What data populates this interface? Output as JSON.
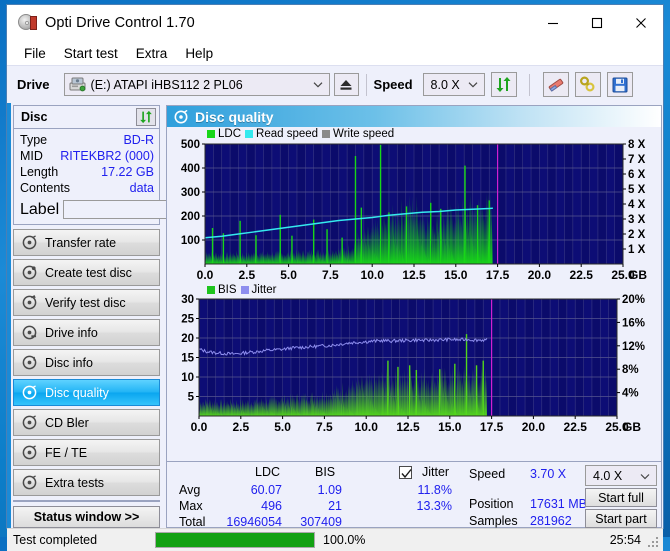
{
  "window": {
    "title": "Opti Drive Control 1.70",
    "icon": "disc-icon",
    "minimize": "–",
    "maximize": "□",
    "close": "✕"
  },
  "menu": {
    "items": [
      "File",
      "Start test",
      "Extra",
      "Help"
    ]
  },
  "toolbar": {
    "drive_label": "Drive",
    "drive_value": "(E:)  ATAPI iHBS112  2 PL06",
    "eject_icon": "eject-icon",
    "speed_label": "Speed",
    "speed_value": "8.0 X",
    "refresh_icon": "refresh-icon",
    "erase_icon": "eraser-icon",
    "tools_icon": "wrench-icon",
    "save_icon": "floppy-save-icon"
  },
  "disc_panel": {
    "title": "Disc",
    "refresh_icon": "refresh-icon",
    "rows": [
      {
        "key": "Type",
        "value": "BD-R"
      },
      {
        "key": "MID",
        "value": "RITEKBR2 (000)"
      },
      {
        "key": "Length",
        "value": "17.22 GB"
      },
      {
        "key": "Contents",
        "value": "data"
      }
    ],
    "label_key": "Label",
    "label_value": "",
    "label_placeholder": "",
    "cd_icon": "cd-disc-icon"
  },
  "nav": {
    "items": [
      {
        "label": "Transfer rate",
        "icon": "disc-icon",
        "selected": false
      },
      {
        "label": "Create test disc",
        "icon": "disc-icon",
        "selected": false
      },
      {
        "label": "Verify test disc",
        "icon": "disc-icon",
        "selected": false
      },
      {
        "label": "Drive info",
        "icon": "disc-icon",
        "selected": false
      },
      {
        "label": "Disc info",
        "icon": "disc-icon",
        "selected": false
      },
      {
        "label": "Disc quality",
        "icon": "disc-icon",
        "selected": true
      },
      {
        "label": "CD Bler",
        "icon": "disc-icon",
        "selected": false
      },
      {
        "label": "FE / TE",
        "icon": "disc-icon",
        "selected": false
      },
      {
        "label": "Extra tests",
        "icon": "disc-icon",
        "selected": false
      }
    ],
    "status_window": "Status window >>"
  },
  "panel": {
    "title": "Disc quality",
    "icon": "disc-icon"
  },
  "stats": {
    "col_ldc": "LDC",
    "col_bis": "BIS",
    "jitter_label": "Jitter",
    "jitter_checked": true,
    "rows": [
      {
        "name": "Avg",
        "ldc": "60.07",
        "bis": "1.09",
        "jitter": "11.8%"
      },
      {
        "name": "Max",
        "ldc": "496",
        "bis": "21",
        "jitter": "13.3%"
      },
      {
        "name": "Total",
        "ldc": "16946054",
        "bis": "307409",
        "jitter": ""
      }
    ],
    "speed_label": "Speed",
    "speed_value": "3.70 X",
    "position_label": "Position",
    "position_value": "17631 MB",
    "samples_label": "Samples",
    "samples_value": "281962",
    "speed_select": "4.0 X",
    "start_full": "Start full",
    "start_part": "Start part"
  },
  "statusbar": {
    "message": "Test completed",
    "percent": "100.0%",
    "percent_value": 100,
    "elapsed": "25:54"
  },
  "colors": {
    "ldc_green": "#18d618",
    "read_speed_cyan": "#34e9ee",
    "write_speed_gray": "#8a8a8a",
    "bis_green": "#53d61c",
    "jitter_violet": "#8e8eee",
    "plot_bg": "#0b0b6b",
    "accent_blue": "#1b8ad6",
    "value_blue": "#2020ee",
    "progress_green": "#12a112"
  },
  "chart_data": [
    {
      "type": "area",
      "name": "disc-quality-ldc",
      "title": "Disc quality",
      "legend": [
        {
          "label": "LDC",
          "color": "#18d618"
        },
        {
          "label": "Read speed",
          "color": "#34e9ee"
        },
        {
          "label": "Write speed",
          "color": "#8a8a8a"
        }
      ],
      "legend_position": "top-left",
      "grid": true,
      "xlabel": "GB",
      "xticks": [
        "0.0",
        "2.5",
        "5.0",
        "7.5",
        "10.0",
        "12.5",
        "15.0",
        "17.5",
        "20.0",
        "22.5",
        "25.0"
      ],
      "xlim": [
        0,
        25
      ],
      "ylabel_left": "LDC",
      "yticks_left": [
        "100",
        "200",
        "300",
        "400",
        "500"
      ],
      "ylim_left": [
        0,
        500
      ],
      "ylabel_right": "X",
      "yticks_right": [
        "1 X",
        "2 X",
        "3 X",
        "4 X",
        "5 X",
        "6 X",
        "7 X",
        "8 X"
      ],
      "ylim_right": [
        0,
        8
      ],
      "data_end_gb": 17.22,
      "marker_line_gb": 17.5,
      "series": [
        {
          "name": "LDC",
          "color": "#18d618",
          "x": [
            0.0,
            0.4,
            0.8,
            1.2,
            1.6,
            2.0,
            2.4,
            2.8,
            3.2,
            3.6,
            4.0,
            4.4,
            4.8,
            5.2,
            5.6,
            6.0,
            6.4,
            6.8,
            7.2,
            7.6,
            8.0,
            8.4,
            8.8,
            9.0,
            9.2,
            9.6,
            10.0,
            10.4,
            10.8,
            11.2,
            11.6,
            12.0,
            12.4,
            12.8,
            13.2,
            13.6,
            14.0,
            14.4,
            14.8,
            15.2,
            15.6,
            16.0,
            16.4,
            16.8,
            17.2
          ],
          "values": [
            48,
            42,
            40,
            38,
            40,
            42,
            38,
            40,
            42,
            40,
            44,
            42,
            40,
            44,
            46,
            44,
            48,
            50,
            48,
            52,
            55,
            60,
            70,
            95,
            105,
            115,
            130,
            150,
            165,
            185,
            200,
            215,
            225,
            215,
            175,
            160,
            170,
            180,
            195,
            205,
            215,
            225,
            218,
            225,
            235
          ]
        },
        {
          "name": "LDC spikes",
          "color": "#18d618",
          "x": [
            0.45,
            1.1,
            2.1,
            3.05,
            4.5,
            5.2,
            6.5,
            7.3,
            8.2,
            9.0,
            9.35,
            10.5,
            11.0,
            12.05,
            13.5,
            14.1,
            15.55,
            16.3,
            17.0
          ],
          "values": [
            150,
            128,
            180,
            120,
            205,
            118,
            185,
            145,
            110,
            450,
            235,
            496,
            215,
            240,
            255,
            230,
            410,
            245,
            265
          ]
        },
        {
          "name": "Read speed",
          "color": "#34e9ee",
          "scale": "right",
          "x": [
            0.0,
            1.0,
            2.0,
            3.0,
            4.0,
            5.0,
            6.0,
            7.0,
            8.0,
            9.0,
            10.0,
            11.0,
            12.0,
            13.0,
            14.0,
            15.0,
            16.0,
            17.0,
            17.22
          ],
          "values": [
            1.75,
            1.85,
            2.0,
            2.15,
            2.3,
            2.45,
            2.6,
            2.75,
            2.9,
            3.0,
            3.1,
            3.25,
            3.35,
            3.45,
            3.5,
            3.6,
            3.65,
            3.7,
            3.72
          ]
        }
      ]
    },
    {
      "type": "area",
      "name": "disc-quality-bis-jitter",
      "legend": [
        {
          "label": "BIS",
          "color": "#53d61c"
        },
        {
          "label": "Jitter",
          "color": "#8e8eee"
        }
      ],
      "legend_position": "top-left",
      "grid": true,
      "xlabel": "GB",
      "xticks": [
        "0.0",
        "2.5",
        "5.0",
        "7.5",
        "10.0",
        "12.5",
        "15.0",
        "17.5",
        "20.0",
        "22.5",
        "25.0"
      ],
      "xlim": [
        0,
        25
      ],
      "ylabel_left": "BIS",
      "yticks_left": [
        "5",
        "10",
        "15",
        "20",
        "25",
        "30"
      ],
      "ylim_left": [
        0,
        30
      ],
      "ylabel_right": "Jitter %",
      "yticks_right": [
        "4%",
        "8%",
        "12%",
        "16%",
        "20%"
      ],
      "ylim_right": [
        0,
        20
      ],
      "data_end_gb": 17.22,
      "marker_line_gb": 17.5,
      "series": [
        {
          "name": "BIS",
          "color": "#53d61c",
          "x": [
            0.0,
            0.5,
            1.0,
            1.5,
            2.0,
            2.5,
            3.0,
            3.5,
            4.0,
            4.5,
            5.0,
            5.5,
            6.0,
            6.5,
            7.0,
            7.5,
            8.0,
            8.5,
            9.0,
            9.5,
            10.0,
            10.5,
            11.0,
            11.5,
            12.0,
            12.5,
            13.0,
            13.5,
            14.0,
            14.5,
            15.0,
            15.5,
            16.0,
            16.5,
            17.0,
            17.22
          ],
          "values": [
            3.4,
            3.6,
            3.4,
            3.2,
            3.4,
            3.3,
            3.5,
            3.6,
            3.8,
            4.0,
            4.2,
            4.4,
            4.6,
            4.8,
            5.0,
            5.2,
            5.6,
            6.6,
            7.2,
            7.6,
            8.0,
            8.4,
            9.0,
            9.2,
            9.4,
            9.0,
            9.2,
            9.4,
            9.0,
            9.4,
            9.6,
            9.8,
            10.0,
            9.8,
            10.0,
            9.6
          ]
        },
        {
          "name": "BIS spikes",
          "color": "#53d61c",
          "x": [
            11.3,
            11.9,
            12.6,
            13.0,
            14.4,
            15.3,
            16.0,
            16.6,
            17.0
          ],
          "values": [
            14.2,
            12.6,
            13.0,
            11.8,
            12.0,
            13.4,
            21.0,
            13.0,
            14.2
          ]
        },
        {
          "name": "Jitter",
          "color": "#8e8eee",
          "scale": "right",
          "x": [
            0.0,
            0.5,
            1.0,
            1.5,
            2.0,
            2.5,
            3.0,
            3.5,
            4.0,
            4.5,
            5.0,
            5.5,
            6.0,
            6.5,
            7.0,
            7.5,
            8.0,
            8.5,
            9.0,
            9.5,
            10.0,
            10.5,
            11.0,
            11.5,
            12.0,
            12.5,
            13.0,
            13.5,
            14.0,
            14.5,
            15.0,
            15.5,
            16.0,
            16.5,
            17.0,
            17.22
          ],
          "values": [
            11.4,
            11.0,
            10.8,
            10.7,
            10.6,
            10.7,
            10.9,
            11.0,
            11.2,
            11.3,
            11.4,
            11.6,
            11.7,
            11.8,
            11.9,
            12.0,
            12.1,
            12.3,
            12.5,
            12.6,
            12.7,
            12.8,
            12.9,
            12.8,
            12.9,
            12.9,
            13.0,
            12.9,
            13.0,
            13.0,
            13.1,
            13.0,
            13.1,
            13.0,
            13.0,
            13.0
          ]
        }
      ]
    }
  ]
}
